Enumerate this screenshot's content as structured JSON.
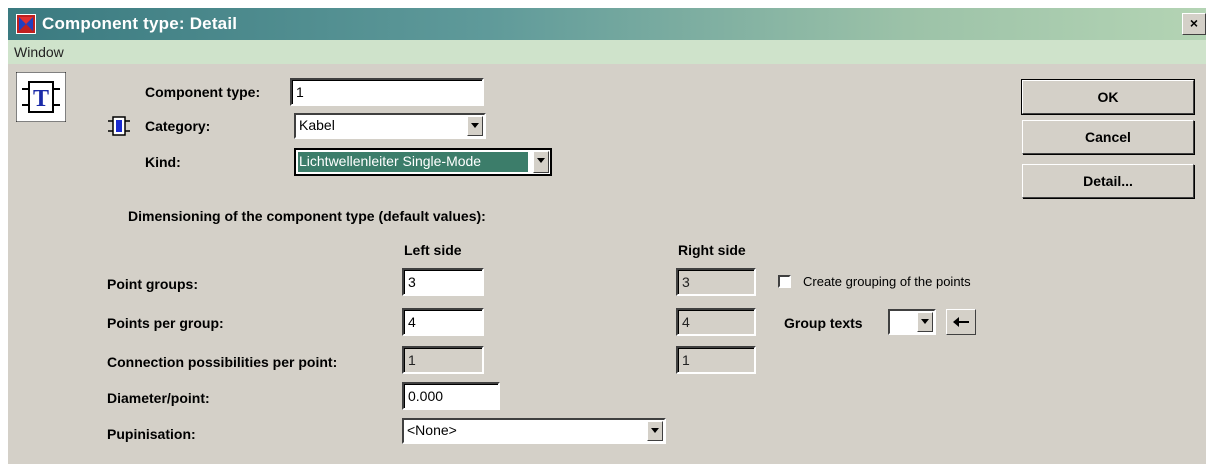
{
  "window": {
    "title": "Component type: Detail",
    "close_label": "×",
    "menu": [
      "Window"
    ]
  },
  "header": {
    "component_type_label": "Component type:",
    "component_type_value": "1",
    "category_label": "Category:",
    "category_value": "Kabel",
    "kind_label": "Kind:",
    "kind_value": "Lichtwellenleiter Single-Mode"
  },
  "buttons": {
    "ok": "OK",
    "cancel": "Cancel",
    "detail": "Detail..."
  },
  "dimensioning": {
    "heading": "Dimensioning of the component type (default values):",
    "left_side": "Left side",
    "right_side": "Right side",
    "rows": [
      {
        "label": "Point groups:",
        "left": "3",
        "right": "3"
      },
      {
        "label": "Points per group:",
        "left": "4",
        "right": "4"
      },
      {
        "label": "Connection possibilities per point:",
        "left": "1",
        "right": "1"
      }
    ],
    "diameter_label": "Diameter/point:",
    "diameter_value": "0.000",
    "pupinisation_label": "Pupinisation:",
    "pupinisation_value": "<None>"
  },
  "options": {
    "create_grouping_label": "Create grouping of the points",
    "create_grouping_checked": false,
    "group_texts_label": "Group texts",
    "group_texts_value": ""
  },
  "icons": {
    "app": "app-window-icon",
    "component_type": "component-T-icon",
    "category": "category-block-icon",
    "arrow": "arrow-left-icon"
  }
}
